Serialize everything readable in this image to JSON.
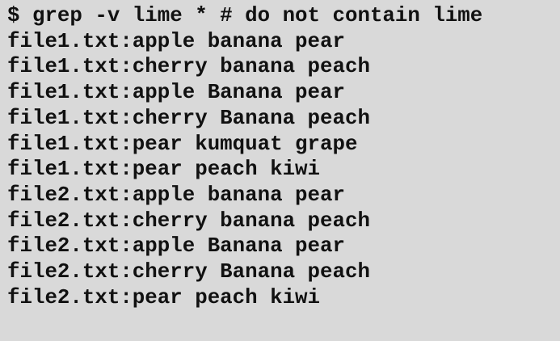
{
  "terminal": {
    "command": "$ grep -v lime * # do not contain lime",
    "output": [
      "file1.txt:apple banana pear",
      "file1.txt:cherry banana peach",
      "file1.txt:apple Banana pear",
      "file1.txt:cherry Banana peach",
      "file1.txt:pear kumquat grape",
      "file1.txt:pear peach kiwi",
      "file2.txt:apple banana pear",
      "file2.txt:cherry banana peach",
      "file2.txt:apple Banana pear",
      "file2.txt:cherry Banana peach",
      "file2.txt:pear peach kiwi"
    ]
  },
  "colors": {
    "background": "#d9d9d9",
    "text": "#111111"
  }
}
